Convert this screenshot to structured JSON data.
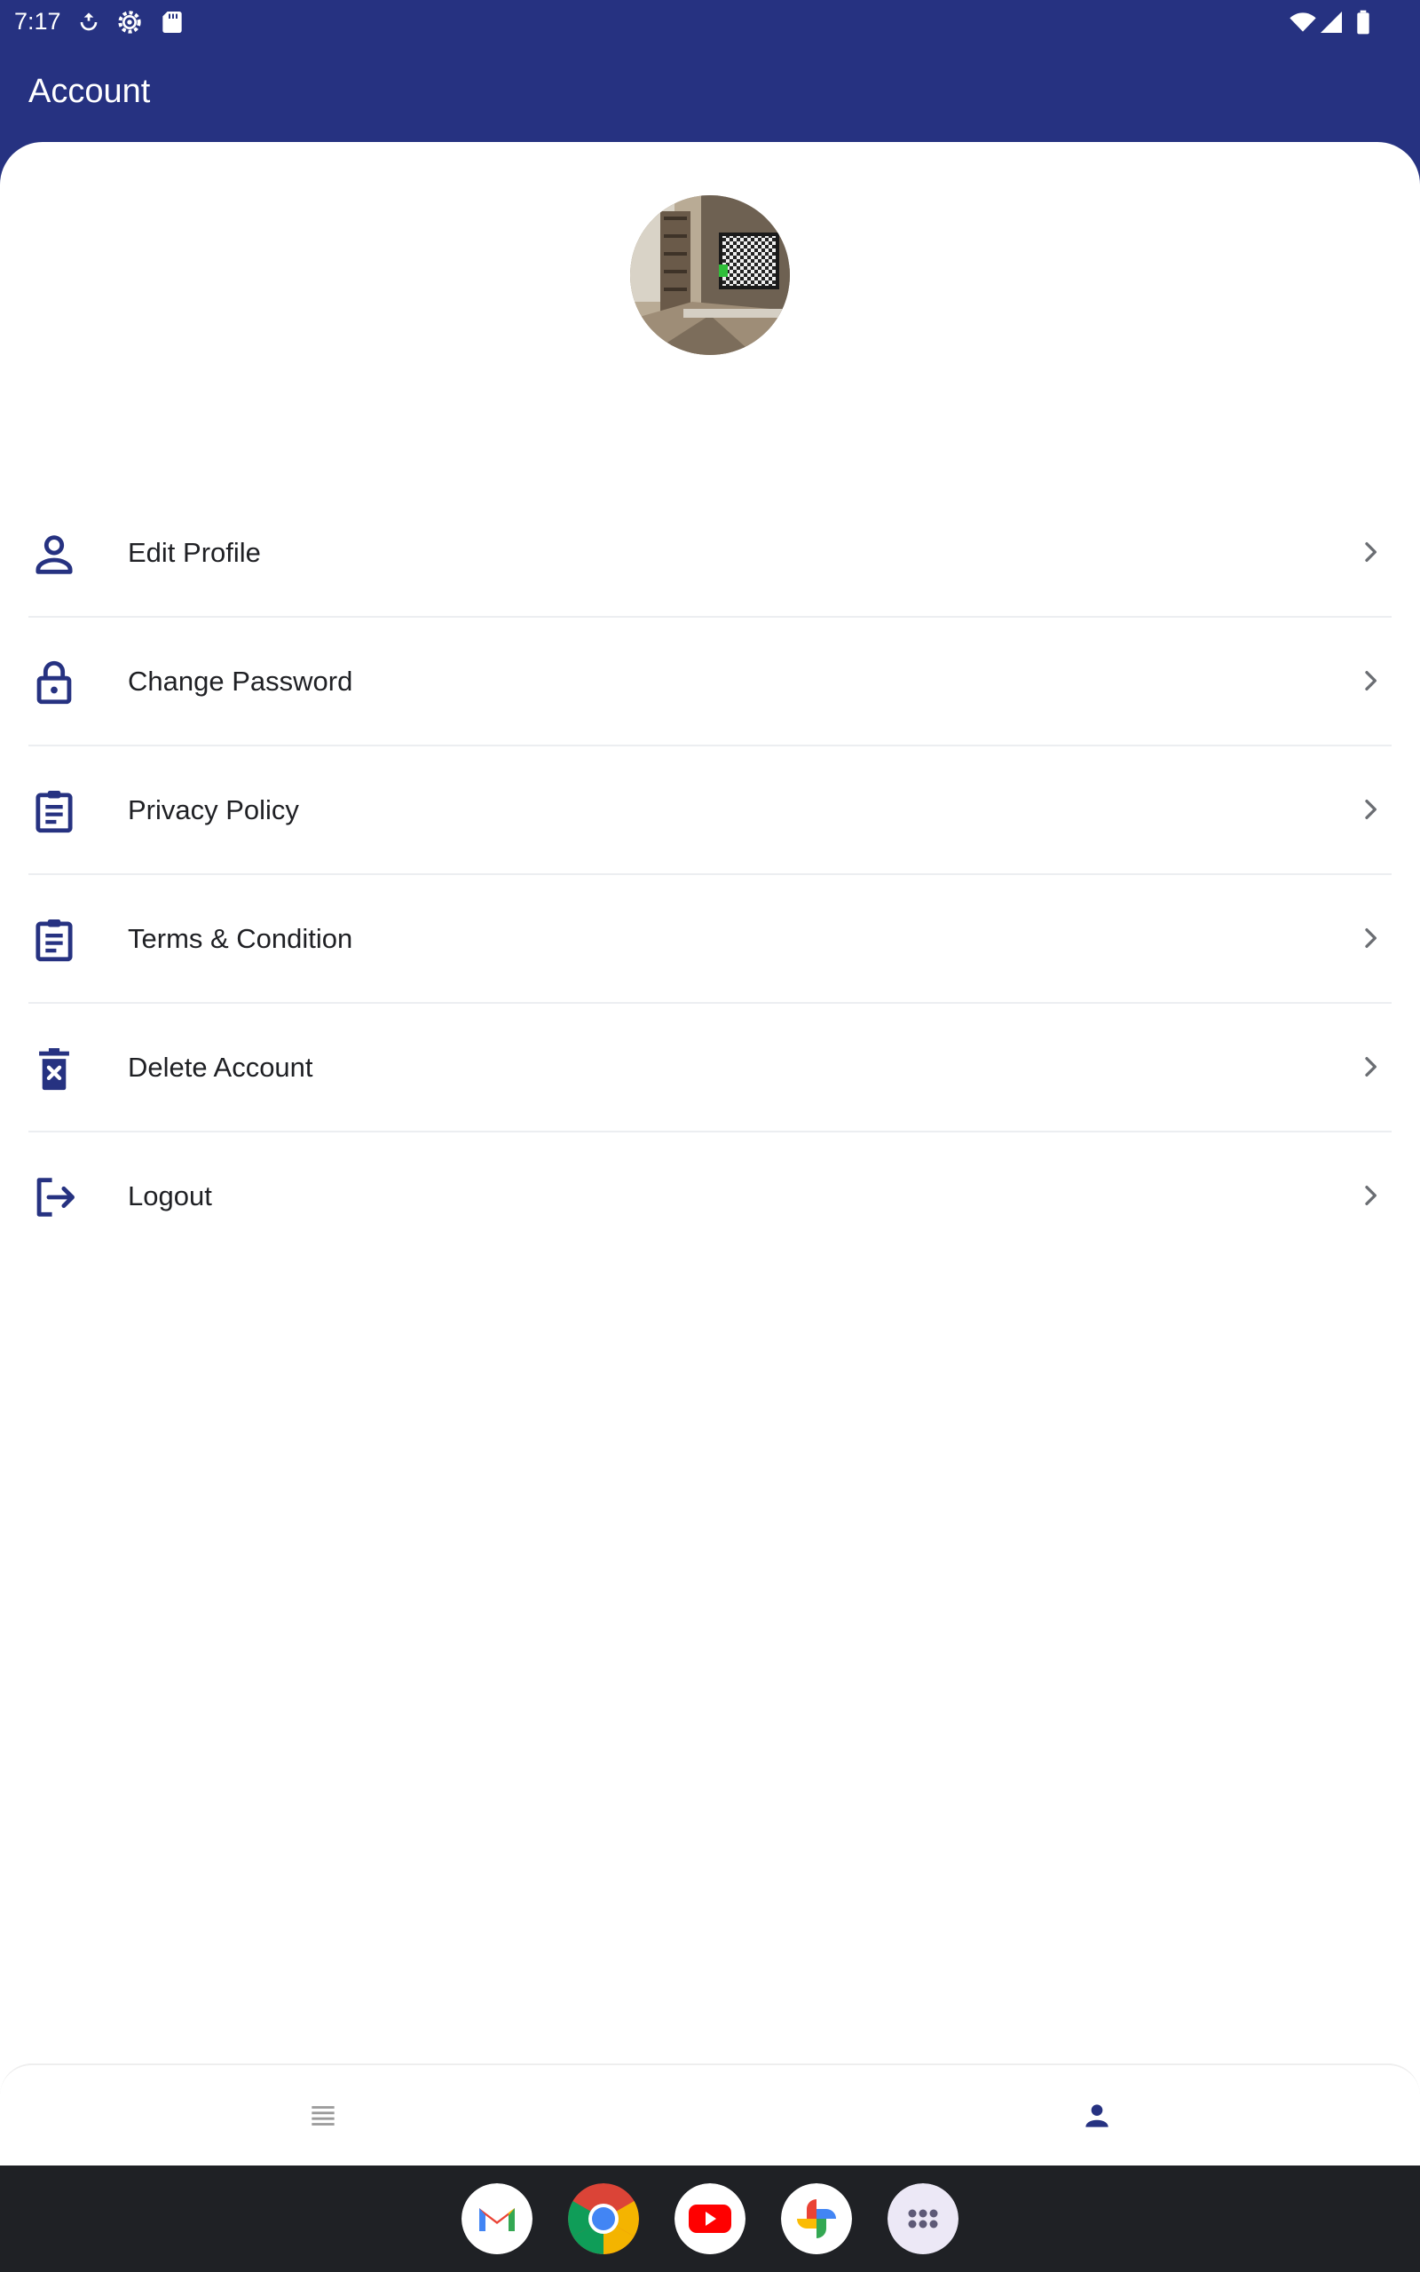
{
  "status_bar": {
    "time": "7:17",
    "icons": [
      "data-saver-icon",
      "settings-gear-icon",
      "sd-card-icon",
      "wifi-icon",
      "cell-signal-icon",
      "battery-icon"
    ]
  },
  "app_bar": {
    "title": "Account"
  },
  "profile": {
    "avatar": "profile-photo"
  },
  "menu": {
    "items": [
      {
        "label": "Edit Profile",
        "icon": "person-outline-icon"
      },
      {
        "label": "Change Password",
        "icon": "lock-icon"
      },
      {
        "label": "Privacy Policy",
        "icon": "clipboard-icon"
      },
      {
        "label": "Terms & Condition",
        "icon": "clipboard-icon"
      },
      {
        "label": "Delete Account",
        "icon": "delete-icon"
      },
      {
        "label": "Logout",
        "icon": "logout-icon"
      }
    ]
  },
  "bottom_nav": {
    "items": [
      {
        "icon": "list-icon",
        "active": false
      },
      {
        "icon": "person-icon",
        "active": true
      }
    ]
  },
  "dock": {
    "apps": [
      "gmail-icon",
      "chrome-icon",
      "youtube-icon",
      "photos-icon",
      "app-drawer-icon"
    ]
  },
  "colors": {
    "primary": "#263281",
    "icon": "#263281",
    "text": "#1f2024",
    "chevron": "#6b6e73",
    "nav_inactive": "#9a9a9a",
    "divider": "#eceef1",
    "dock_bg": "#1f2125"
  }
}
